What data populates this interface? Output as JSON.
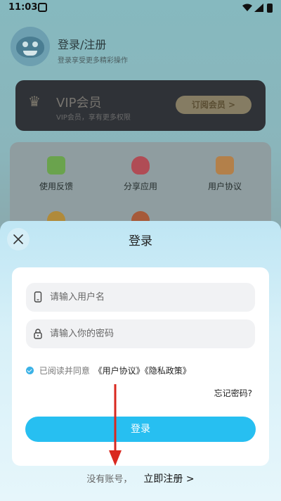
{
  "status_bar": {
    "time": "11:03"
  },
  "profile": {
    "title": "登录/注册",
    "subtitle": "登录享受更多精彩操作"
  },
  "vip": {
    "title": "VIP会员",
    "subtitle": "VIP会员，享有更多权限",
    "button": "订阅会员 >"
  },
  "features": {
    "items": [
      {
        "label": "使用反馈",
        "icon": "feedback-icon",
        "color": "#6aa34d"
      },
      {
        "label": "分享应用",
        "icon": "heart-icon",
        "color": "#b04c55"
      },
      {
        "label": "用户协议",
        "icon": "agreement-icon",
        "color": "#b3804a"
      }
    ]
  },
  "dialog": {
    "title": "登录",
    "username_placeholder": "请输入用户名",
    "password_placeholder": "请输入你的密码",
    "agree_prefix": "已阅读并同意",
    "agree_link_terms": "《用户协议》",
    "agree_link_privacy": "《隐私政策》",
    "forgot_password": "忘记密码?",
    "login_button": "登录",
    "no_account": "没有账号，",
    "register_link": "立即注册 >"
  },
  "colors": {
    "accent": "#27bff1",
    "annotation_arrow": "#d9281f"
  }
}
